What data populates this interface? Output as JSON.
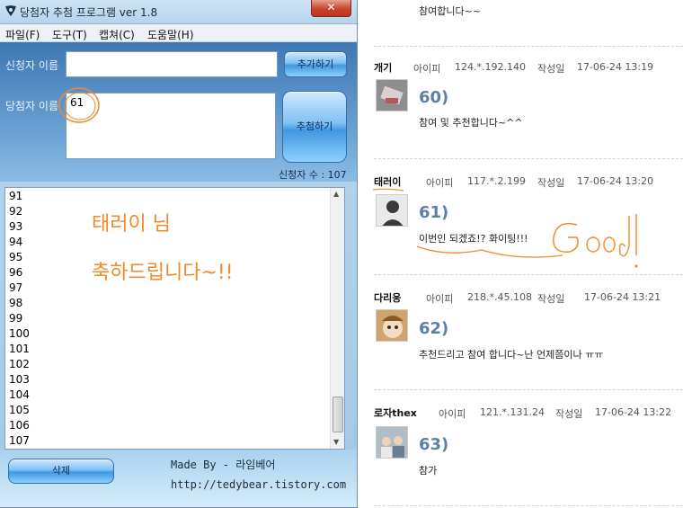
{
  "window": {
    "title": "당첨자 추첨 프로그램 ver 1.8",
    "close_label": "✕"
  },
  "menu": [
    {
      "label": "파일(F)"
    },
    {
      "label": "도구(T)"
    },
    {
      "label": "캡쳐(C)"
    },
    {
      "label": "도움말(H)"
    }
  ],
  "form": {
    "applicant_name_label": "신청자 이름",
    "applicant_name_value": "",
    "winner_label": "당첨자 이름",
    "winner_value": "61",
    "add_button": "추가하기",
    "draw_button": "추첨하기",
    "applicant_count_label": "신청자 수 : 107"
  },
  "list": {
    "rows": [
      "91",
      "92",
      "93",
      "94",
      "95",
      "96",
      "97",
      "98",
      "99",
      "100",
      "101",
      "102",
      "103",
      "104",
      "105",
      "106",
      "107"
    ],
    "annotation_line1": "태러이 님",
    "annotation_line2": "축하드립니다~!!"
  },
  "footer": {
    "delete_button": "삭제",
    "made_by": "Made By - 라임베어",
    "url": "http://tedybear.tistory.com"
  },
  "comments": {
    "top_text": "참여합니다~~",
    "ip_label": "아이피",
    "date_label": "작성일",
    "items": [
      {
        "author": "개기",
        "ip": "124.*.192.140",
        "date": "17-06-24 13:19",
        "number": "60)",
        "text": "참여 및 추천합니다~^^"
      },
      {
        "author": "태러이",
        "ip": "117.*.2.199",
        "date": "17-06-24 13:20",
        "number": "61)",
        "text": "이번인 되겠죠!? 화이팅!!!"
      },
      {
        "author": "다리웅",
        "ip": "218.*.45.108",
        "date": "17-06-24 13:21",
        "number": "62)",
        "text": "추천드리고 참여 합니다~난 언제쯤이나 ㅠㅠ"
      },
      {
        "author": "로자thex",
        "ip": "121.*.131.24",
        "date": "17-06-24 13:22",
        "number": "63)",
        "text": "참가"
      }
    ],
    "handwriting": "Good!"
  },
  "colors": {
    "annotation_orange": "#f08a2c",
    "comment_number_blue": "#5c7fa8",
    "form_blue": "#3f77b3"
  }
}
